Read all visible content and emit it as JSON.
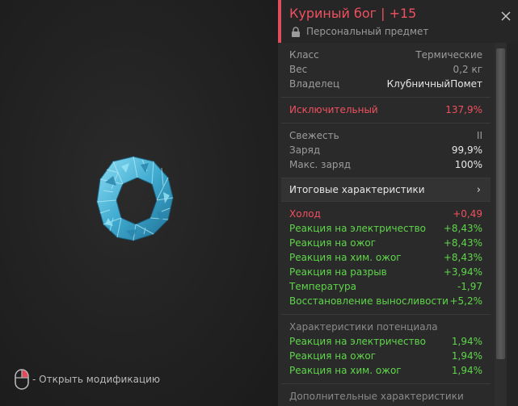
{
  "viewer": {
    "hint_text": "- Открыть модификацию"
  },
  "item": {
    "name": "Куриный бог | +15",
    "subtitle": "Персональный предмет",
    "accent_color": "#f0505f"
  },
  "info": [
    {
      "label": "Класс",
      "value": "Термические"
    },
    {
      "label": "Вес",
      "value": "0,2 кг"
    },
    {
      "label": "Владелец",
      "value": "КлубничныйПомет"
    }
  ],
  "rarity": {
    "label": "Исключительный",
    "value": "137,9%"
  },
  "condition": [
    {
      "label": "Свежесть",
      "value": "II"
    },
    {
      "label": "Заряд",
      "value": "99,9%"
    },
    {
      "label": "Макс. заряд",
      "value": "100%"
    }
  ],
  "summary_label": "Итоговые характеристики",
  "stats": [
    {
      "label": "Холод",
      "value": "+0,49",
      "color": "red"
    },
    {
      "label": "Реакция на электричество",
      "value": "+8,43%",
      "color": "green"
    },
    {
      "label": "Реакция на ожог",
      "value": "+8,43%",
      "color": "green"
    },
    {
      "label": "Реакция на хим. ожог",
      "value": "+8,43%",
      "color": "green"
    },
    {
      "label": "Реакция на разрыв",
      "value": "+3,94%",
      "color": "green"
    },
    {
      "label": "Температура",
      "value": "-1,97",
      "color": "green"
    },
    {
      "label": "Восстановление выносливости",
      "value": "+5,2%",
      "color": "green"
    }
  ],
  "potential": {
    "title": "Характеристики потенциала",
    "rows": [
      {
        "label": "Реакция на электричество",
        "value": "1,94%"
      },
      {
        "label": "Реакция на ожог",
        "value": "1,94%"
      },
      {
        "label": "Реакция на хим. ожог",
        "value": "1,94%"
      }
    ]
  },
  "additional_title": "Дополнительные характеристики",
  "colors": {
    "red": "#f0505f",
    "green": "#5fd64a",
    "crystal": "#4fb8d8"
  },
  "icons": [
    "mouse-icon",
    "lock-icon",
    "close-icon",
    "chevron-right-icon",
    "artifact-icon"
  ]
}
